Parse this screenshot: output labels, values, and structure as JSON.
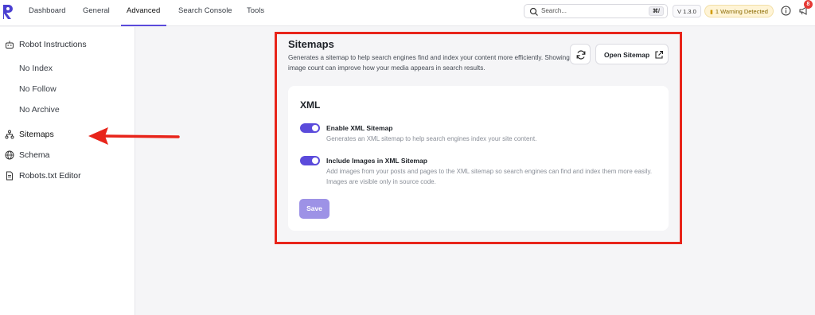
{
  "topbar": {
    "tabs": [
      {
        "label": "Dashboard",
        "active": false
      },
      {
        "label": "General",
        "active": false
      },
      {
        "label": "Advanced",
        "active": true
      },
      {
        "label": "Search Console",
        "active": false
      },
      {
        "label": "Tools",
        "active": false
      }
    ],
    "search_placeholder": "Search...",
    "search_shortcut": "⌘/",
    "version": "V 1.3.0",
    "warning_text": "1 Warning Detected",
    "notification_count": "8"
  },
  "sidebar": {
    "items": [
      {
        "label": "Robot Instructions",
        "icon": "robot-icon"
      },
      {
        "label": "No Index"
      },
      {
        "label": "No Follow"
      },
      {
        "label": "No Archive"
      },
      {
        "label": "Sitemaps",
        "icon": "sitemap-icon",
        "active": true
      },
      {
        "label": "Schema",
        "icon": "globe-icon"
      },
      {
        "label": "Robots.txt Editor",
        "icon": "document-icon"
      }
    ]
  },
  "main": {
    "title": "Sitemaps",
    "description": "Generates a sitemap to help search engines find and index your content more efficiently. Showing image count can improve how your media appears in search results.",
    "open_sitemap_label": "Open Sitemap",
    "xml": {
      "title": "XML",
      "options": [
        {
          "label": "Enable XML Sitemap",
          "description": "Generates an XML sitemap to help search engines index your site content.",
          "enabled": true
        },
        {
          "label": "Include Images in XML Sitemap",
          "description": "Add images from your posts and pages to the XML sitemap so search engines can find and index them more easily. Images are visible only in source code.",
          "enabled": true
        }
      ],
      "save_label": "Save"
    }
  },
  "colors": {
    "accent": "#5b4bdb",
    "save_disabled": "#9d92e6",
    "annotation_red": "#e8241a",
    "warning_bg": "#fff4d6"
  }
}
